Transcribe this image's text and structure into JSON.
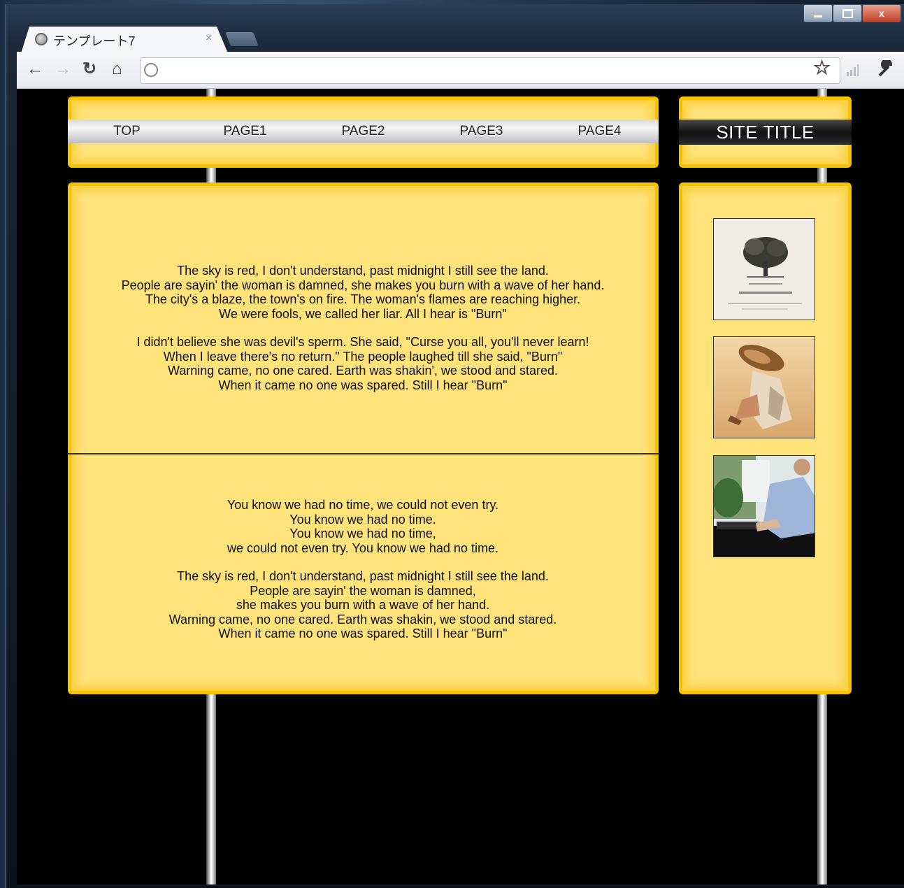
{
  "browser": {
    "tab_title": "テンプレート7",
    "tab_close": "×"
  },
  "nav": {
    "items": [
      "TOP",
      "PAGE1",
      "PAGE2",
      "PAGE3",
      "PAGE4"
    ]
  },
  "site": {
    "title": "SITE TITLE"
  },
  "content": {
    "section1": [
      [
        "The sky is red, I don't understand, past midnight I still see the land.",
        "People are sayin' the woman is damned, she makes you burn with a wave of her hand.",
        "The city's a blaze, the town's on fire. The woman's flames are reaching higher.",
        "We were fools, we called her liar. All I hear is \"Burn\""
      ],
      [
        "I didn't believe she was devil's sperm. She said, \"Curse you all, you'll never learn!",
        "When I leave there's no return.\" The people laughed till she said, \"Burn\"",
        "Warning came, no one cared. Earth was shakin', we stood and stared.",
        "When it came no one was spared. Still I hear \"Burn\""
      ]
    ],
    "section2": [
      [
        "You know we had no time, we could not even try.",
        "You know we had no time.",
        "You know we had no time,",
        "we could not even try. You know we had no time."
      ],
      [
        "The sky is red, I don't understand, past midnight I still see the land.",
        "People are sayin' the woman is damned,",
        "she makes you burn with a wave of her hand.",
        "Warning came, no one cared. Earth was shakin, we stood and stared.",
        "When it came no one was spared. Still I hear \"Burn\""
      ]
    ]
  },
  "sidebar": {
    "images": [
      "book-cover-tree",
      "painting-fish-figure",
      "man-typing-photo"
    ]
  }
}
